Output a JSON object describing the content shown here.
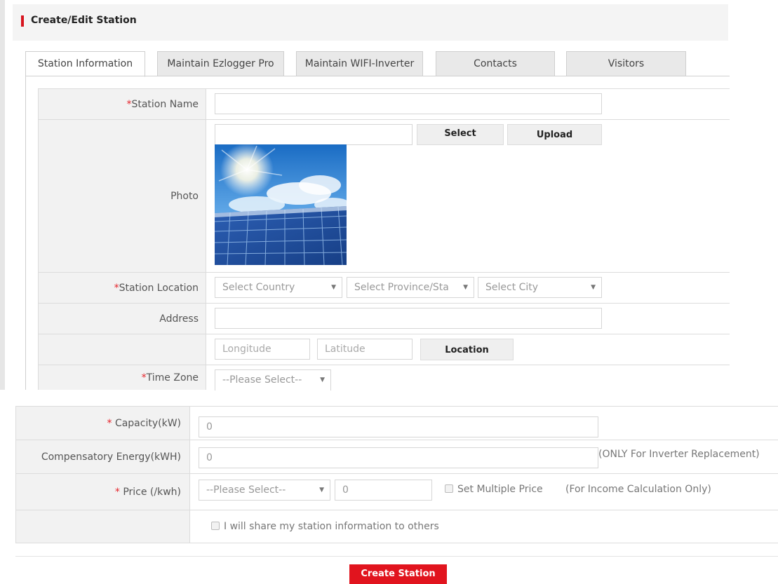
{
  "header": {
    "title": "Create/Edit Station"
  },
  "tabs": [
    {
      "label": "Station Information",
      "active": true
    },
    {
      "label": "Maintain Ezlogger Pro",
      "active": false
    },
    {
      "label": "Maintain WIFI-Inverter",
      "active": false
    },
    {
      "label": "Contacts",
      "active": false
    },
    {
      "label": "Visitors",
      "active": false
    }
  ],
  "form": {
    "station_name": {
      "required_mark": "*",
      "label": "Station Name",
      "value": ""
    },
    "photo": {
      "label": "Photo",
      "file_value": "",
      "select_label": "Select",
      "upload_label": "Upload",
      "image_subject": "solar-panel-sky"
    },
    "station_location": {
      "required_mark": "*",
      "label": "Station Location",
      "country_placeholder": "Select Country",
      "province_placeholder": "Select Province/Sta",
      "city_placeholder": "Select City"
    },
    "address": {
      "label": "Address",
      "value": ""
    },
    "coordinates": {
      "longitude_placeholder": "Longitude",
      "latitude_placeholder": "Latitude",
      "location_button": "Location"
    },
    "time_zone": {
      "required_mark": "*",
      "label": "Time Zone",
      "placeholder": "--Please Select--"
    },
    "capacity": {
      "required_mark": "* ",
      "label": "Capacity(kW)",
      "value": "0"
    },
    "compensatory_energy": {
      "label": "Compensatory Energy(kWH)",
      "value": "0",
      "note": "(ONLY For Inverter Replacement)"
    },
    "price": {
      "required_mark": "* ",
      "label": "Price (/kwh)",
      "currency_placeholder": "--Please Select--",
      "value": "0",
      "multiple_price_label": "Set Multiple Price",
      "multiple_price_checked": false,
      "income_note": "(For Income Calculation Only)"
    },
    "share": {
      "label": "I will share my station information to others",
      "checked": false
    }
  },
  "footer": {
    "create_button": "Create Station"
  },
  "colors": {
    "accent": "#e1141e",
    "label_bg": "#f2f2f2",
    "border": "#dcdcdc"
  }
}
